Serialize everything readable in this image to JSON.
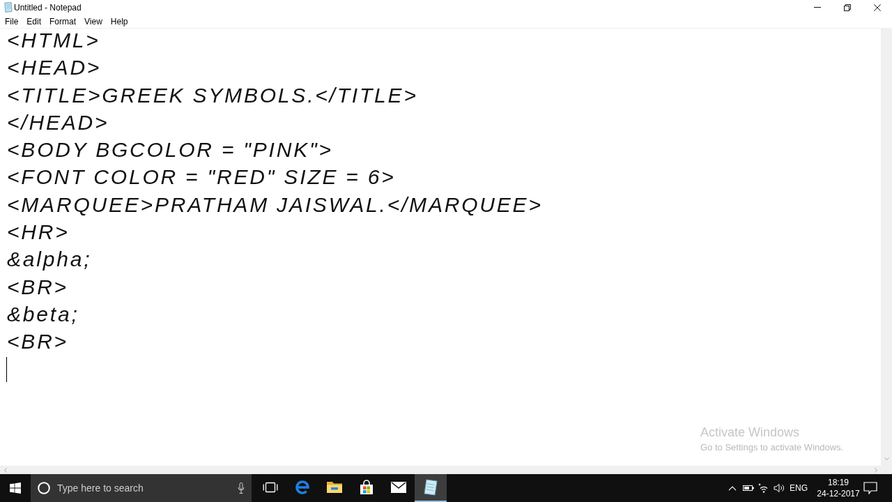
{
  "window": {
    "title": "Untitled - Notepad"
  },
  "menu": [
    "File",
    "Edit",
    "Format",
    "View",
    "Help"
  ],
  "editor": {
    "lines": [
      "<HTML>",
      "<HEAD>",
      "<TITLE>GREEK SYMBOLS.</TITLE>",
      "</HEAD>",
      "<BODY BGCOLOR = \"PINK\">",
      "<FONT COLOR = \"RED\" SIZE = 6>",
      "<MARQUEE>PRATHAM JAISWAL.</MARQUEE>",
      "<HR>",
      "&alpha;",
      "<BR>",
      "&beta;",
      "<BR>"
    ],
    "caret_visible": true
  },
  "activation_notice": {
    "title": "Activate Windows",
    "message": "Go to Settings to activate Windows."
  },
  "taskbar": {
    "search": {
      "placeholder": "Type here to search"
    },
    "apps": [
      {
        "kind": "task-view",
        "selected": false
      },
      {
        "kind": "browser",
        "selected": false
      },
      {
        "kind": "folder",
        "selected": false
      },
      {
        "kind": "store",
        "selected": false
      },
      {
        "kind": "mail",
        "selected": false
      },
      {
        "kind": "notepad",
        "selected": true
      }
    ],
    "tray": {
      "language": "ENG",
      "time": "18:19",
      "date": "24-12-2017"
    }
  }
}
